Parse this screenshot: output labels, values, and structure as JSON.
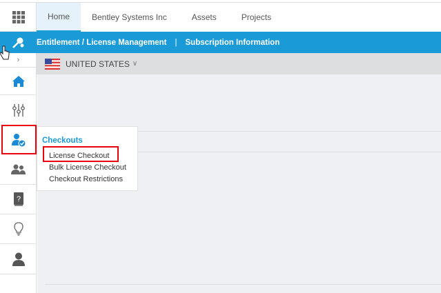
{
  "tabs": [
    {
      "label": "Home"
    },
    {
      "label": "Bentley Systems Inc"
    },
    {
      "label": "Assets"
    },
    {
      "label": "Projects"
    }
  ],
  "bluebar": {
    "link1": "Entitlement / License Management",
    "separator": "|",
    "link2": "Subscription Information"
  },
  "country": {
    "label": "UNITED STATES"
  },
  "menu": {
    "title": "Checkouts",
    "items": [
      {
        "label": "License Checkout"
      },
      {
        "label": "Bulk License Checkout"
      },
      {
        "label": "Checkout Restrictions"
      }
    ]
  },
  "colors": {
    "accent": "#1a9ad6",
    "highlight": "#e8000b"
  }
}
